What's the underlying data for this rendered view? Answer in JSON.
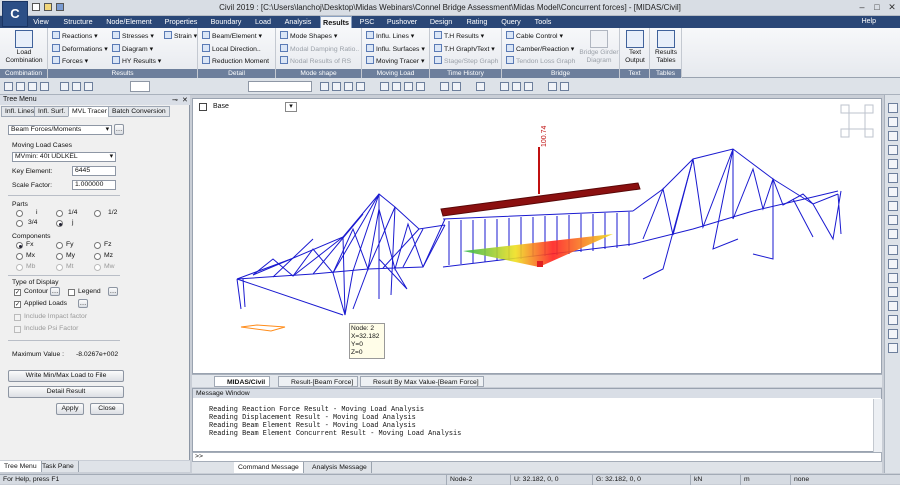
{
  "titlebar": {
    "title": "Civil 2019 : [C:\\Users\\lanchoj\\Desktop\\Midas Webinars\\Connel Bridge Assessment\\Midas Model\\Concurrent forces] - [MIDAS/Civil]",
    "app_icon": "C",
    "minimize": "–",
    "maximize": "□",
    "close": "✕"
  },
  "menu": {
    "tabs": [
      "View",
      "Structure",
      "Node/Element",
      "Properties",
      "Boundary",
      "Load",
      "Analysis",
      "Results",
      "PSC",
      "Pushover",
      "Design",
      "Rating",
      "Query",
      "Tools"
    ],
    "active": "Results",
    "help": "Help"
  },
  "ribbon": {
    "combination": {
      "title": "Combination",
      "load_combination": "Load\nCombination"
    },
    "results": {
      "title": "Results",
      "reactions": "Reactions",
      "deformations": "Deformations",
      "forces": "Forces",
      "stresses": "Stresses",
      "diagram": "Diagram",
      "hy_results": "HY Results",
      "strain": "Strain"
    },
    "detail": {
      "title": "Detail",
      "beam_element": "Beam/Element",
      "local_direction": "Local Direction..",
      "reduction_moment": "Reduction Moment"
    },
    "mode_shape": {
      "title": "Mode shape",
      "mode_shapes": "Mode Shapes",
      "modal_damping": "Modal Damping Ratio..",
      "nodal_results": "Nodal Results of RS"
    },
    "moving_load": {
      "title": "Moving Load",
      "influ_lines": "Influ. Lines",
      "influ_surfaces": "Influ. Surfaces",
      "moving_tracer": "Moving Tracer"
    },
    "time_history": {
      "title": "Time History",
      "th_results": "T.H Results",
      "th_graph": "T.H Graph/Text",
      "stage_graph": "Stage/Step Graph"
    },
    "bridge": {
      "title": "Bridge",
      "cable_control": "Cable Control",
      "camber_reaction": "Camber/Reaction",
      "tendon_loss": "Tendon Loss Graph",
      "bridge_girder": "Bridge Girder\nDiagram"
    },
    "text": {
      "title": "Text",
      "text_output": "Text\nOutput"
    },
    "tables": {
      "title": "Tables",
      "results_tables": "Results\nTables"
    }
  },
  "tree_menu": {
    "title": "Tree Menu",
    "tabs": [
      "Infl. Lines",
      "Infl. Surf.",
      "MVL Tracer",
      "Batch Conversion"
    ],
    "active_tab": "MVL Tracer",
    "result_type": "Beam Forces/Moments",
    "moving_load_cases_label": "Moving Load Cases",
    "moving_load_case": "MVmin: 40t UDLKEL",
    "key_element_label": "Key Element:",
    "key_element": "6445",
    "scale_factor_label": "Scale Factor:",
    "scale_factor": "1.000000",
    "parts_label": "Parts",
    "parts": [
      "i",
      "1/4",
      "1/2",
      "3/4",
      "j"
    ],
    "parts_selected": "j",
    "components_label": "Components",
    "components": [
      "Fx",
      "Fy",
      "Fz",
      "Mx",
      "My",
      "Mz",
      "Mb",
      "Mt",
      "Mw"
    ],
    "component_selected": "Fx",
    "type_of_display_label": "Type of Display",
    "contour": "Contour",
    "legend": "Legend",
    "applied_loads": "Applied Loads",
    "include_impact": "Include Impact factor",
    "include_psi": "Include Psi Factor",
    "max_value_label": "Maximum Value :",
    "max_value": "-8.0267e+002",
    "write_btn": "Write Min/Max Load to File",
    "detail_btn": "Detail Result",
    "apply_btn": "Apply",
    "close_btn": "Close",
    "bottom_tabs": [
      "Tree Menu",
      "Task Pane"
    ]
  },
  "view": {
    "base_select": "Base",
    "load_label": "100.74",
    "tooltip": [
      "Node: 2",
      "X=32.182",
      "Y=0",
      "Z=0"
    ],
    "tabs": [
      "MIDAS/Civil",
      "Result-[Beam Force]",
      "Result By Max Value-[Beam Force]"
    ]
  },
  "messages": {
    "title": "Message Window",
    "lines": [
      "Reading Reaction Force Result - Moving Load Analysis",
      "Reading Displacement Result - Moving Load Analysis",
      "Reading Beam Element Result - Moving Load Analysis",
      "Reading Beam Element Concurrent Result - Moving Load Analysis"
    ],
    "prompt": ">>",
    "tabs": [
      "Command Message",
      "Analysis Message"
    ]
  },
  "status": {
    "help": "For Help, press F1",
    "node": "Node-2",
    "u": "U: 32.182, 0, 0",
    "g": "G: 32.182, 0, 0",
    "force_unit": "kN",
    "length_unit": "m",
    "none": "none"
  },
  "colors": {
    "menubar": "#2a4777",
    "truss": "#1a1ad0",
    "deck": "#8b1010",
    "accent": "#6d7f9c"
  }
}
